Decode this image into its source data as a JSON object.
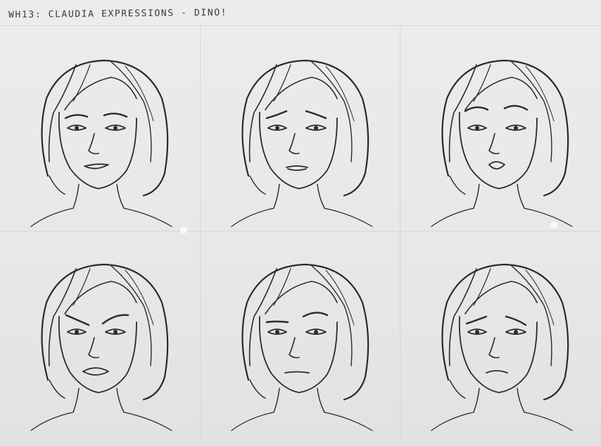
{
  "sheet": {
    "title": "WH13: CLAUDIA EXPRESSIONS  - DINO!",
    "paper_color": "#e9e9e9",
    "ink_color": "#2a2a2a"
  },
  "panels": [
    {
      "expression": "confident"
    },
    {
      "expression": "worried"
    },
    {
      "expression": "surprised"
    },
    {
      "expression": "angry"
    },
    {
      "expression": "skeptical"
    },
    {
      "expression": "sad"
    }
  ]
}
